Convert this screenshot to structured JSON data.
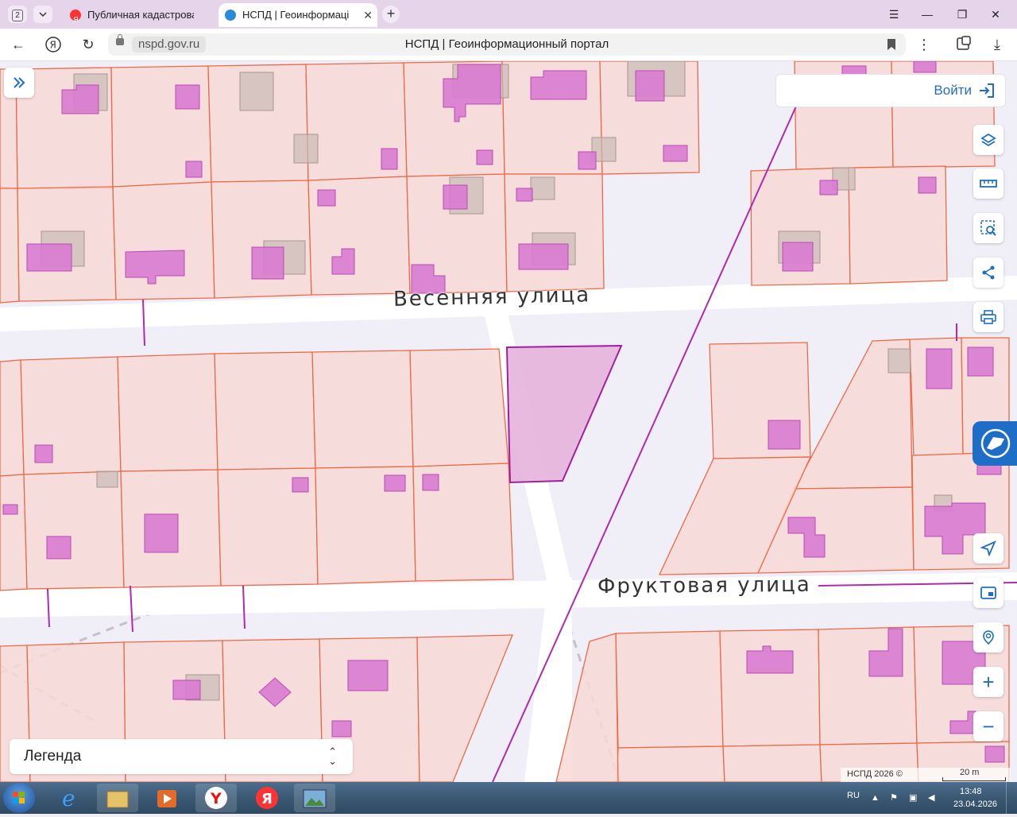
{
  "browser": {
    "tab_count": "2",
    "tabs": [
      {
        "title": "Публичная кадастровая к",
        "active": false
      },
      {
        "title": "НСПД | Геоинформаці",
        "active": true
      }
    ],
    "url": "nspd.gov.ru",
    "page_title": "НСПД | Геоинформационный портал"
  },
  "map": {
    "streets": [
      "Весенняя улица",
      "Фруктовая улица"
    ],
    "colors": {
      "parcel_fill": "#f7d9d6",
      "parcel_stroke": "#ec6a47",
      "building_fill": "#d97bd2",
      "building_stroke": "#b94cb2",
      "highlight_fill": "#e5b3dd",
      "highlight_stroke": "#a020a0",
      "road": "#ffffff",
      "gray_footprint": "#c9bab6"
    }
  },
  "controls": {
    "login_label": "Войти",
    "legend_label": "Легенда",
    "copyright": "НСПД 2026 ©",
    "scale_label": "20 m",
    "tools": [
      "layers-icon",
      "ruler-icon",
      "select-search-icon",
      "share-icon",
      "print-icon",
      "locate-arrow-icon",
      "minimap-icon",
      "geosearch-icon",
      "zoom-in-icon",
      "zoom-out-icon"
    ],
    "zoom_in": "+",
    "zoom_out": "−"
  },
  "taskbar": {
    "lang": "RU",
    "time": "13:48",
    "date": "23.04.2026"
  }
}
